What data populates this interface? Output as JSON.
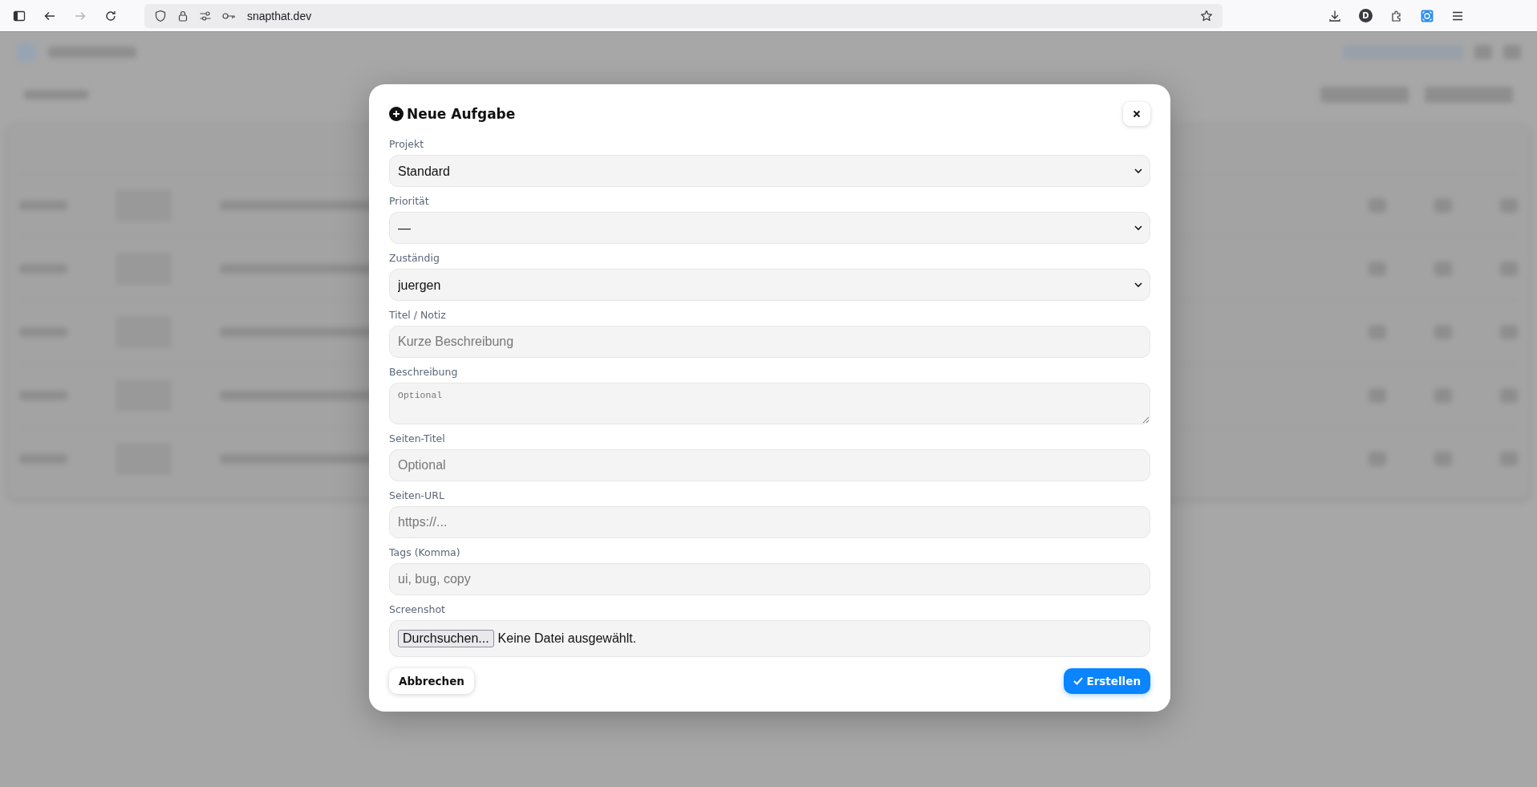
{
  "browser": {
    "url": "snapthat.dev",
    "profile_initial": "D",
    "forward_disabled": true
  },
  "dialog": {
    "title": "Neue Aufgabe",
    "fields": [
      {
        "kind": "select",
        "label": "Projekt",
        "value": "Standard"
      },
      {
        "kind": "select",
        "label": "Priorität",
        "value": "—"
      },
      {
        "kind": "select",
        "label": "Zuständig",
        "value": "juergen"
      },
      {
        "kind": "input",
        "label": "Titel / Notiz",
        "placeholder": "Kurze Beschreibung"
      },
      {
        "kind": "textarea",
        "label": "Beschreibung",
        "placeholder": "Optional"
      },
      {
        "kind": "input",
        "label": "Seiten-Titel",
        "placeholder": "Optional"
      },
      {
        "kind": "input",
        "label": "Seiten-URL",
        "placeholder": "https://..."
      },
      {
        "kind": "input",
        "label": "Tags (Komma)",
        "placeholder": "ui, bug, copy"
      },
      {
        "kind": "file",
        "label": "Screenshot",
        "button": "Durchsuchen...",
        "status": "Keine Datei ausgewählt."
      }
    ],
    "cancel": "Abbrechen",
    "submit": "Erstellen"
  }
}
